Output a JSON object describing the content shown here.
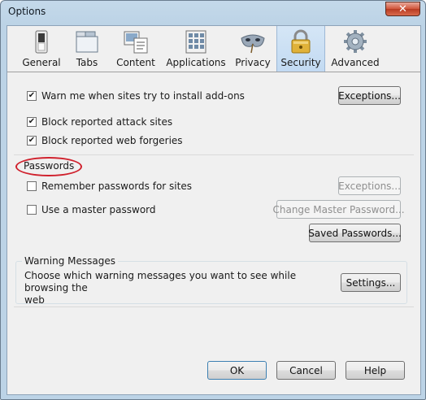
{
  "window": {
    "title": "Options",
    "close_glyph": "✕"
  },
  "toolbar": {
    "tabs": [
      {
        "label": "General",
        "icon": "switch-icon"
      },
      {
        "label": "Tabs",
        "icon": "tabs-icon"
      },
      {
        "label": "Content",
        "icon": "content-icon"
      },
      {
        "label": "Applications",
        "icon": "applications-icon"
      },
      {
        "label": "Privacy",
        "icon": "mask-icon"
      },
      {
        "label": "Security",
        "icon": "padlock-icon"
      },
      {
        "label": "Advanced",
        "icon": "gear-icon"
      }
    ],
    "selected": "Security"
  },
  "security": {
    "warn_addons": {
      "label": "Warn me when sites try to install add-ons",
      "checked": true
    },
    "warn_addons_exceptions": "Exceptions...",
    "block_attack": {
      "label": "Block reported attack sites",
      "checked": true
    },
    "block_forgeries": {
      "label": "Block reported web forgeries",
      "checked": true
    }
  },
  "passwords": {
    "heading": "Passwords",
    "remember": {
      "label": "Remember passwords for sites",
      "checked": false
    },
    "remember_exceptions": "Exceptions...",
    "master": {
      "label": "Use a master password",
      "checked": false
    },
    "change_master": "Change Master Password...",
    "saved": "Saved Passwords..."
  },
  "warnings": {
    "heading": "Warning Messages",
    "description_line1": "Choose which warning messages you want to see while browsing the",
    "description_line2": "web",
    "settings": "Settings..."
  },
  "footer": {
    "ok": "OK",
    "cancel": "Cancel",
    "help": "Help"
  },
  "colors": {
    "annotation": "#d0212d",
    "selected_tab": "#c2daf2"
  }
}
